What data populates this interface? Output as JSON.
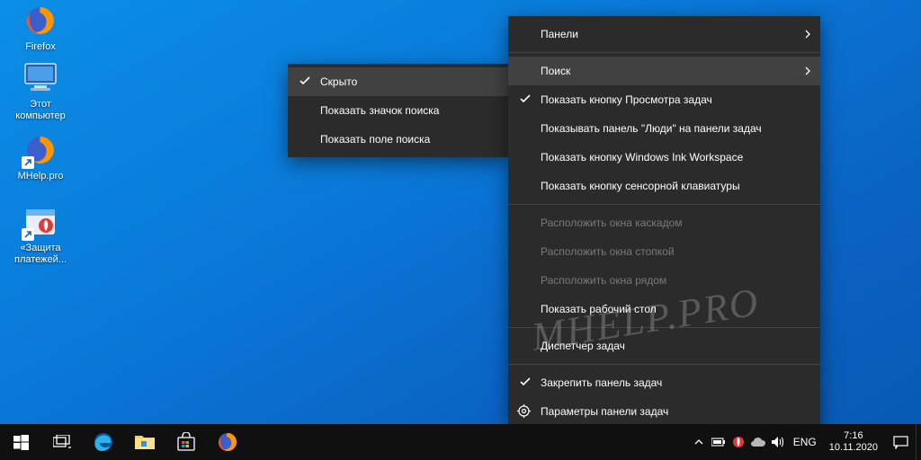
{
  "desktop_icons": {
    "firefox": "Firefox",
    "this_pc": "Этот\nкомпьютер",
    "mhelp": "MHelp.pro",
    "protection": "«Защита\nплатежей..."
  },
  "submenu": {
    "hidden": "Скрыто",
    "show_icon": "Показать значок поиска",
    "show_box": "Показать поле поиска"
  },
  "mainmenu": {
    "panels": "Панели",
    "search": "Поиск",
    "task_view": "Показать кнопку Просмотра задач",
    "people": "Показывать панель \"Люди\" на панели задач",
    "ink": "Показать кнопку Windows Ink Workspace",
    "touchkb": "Показать кнопку сенсорной клавиатуры",
    "cascade": "Расположить окна каскадом",
    "stacked": "Расположить окна стопкой",
    "sidebyside": "Расположить окна рядом",
    "show_desktop": "Показать рабочий стол",
    "task_manager": "Диспетчер задач",
    "lock": "Закрепить панель задач",
    "settings": "Параметры панели задач"
  },
  "tray": {
    "lang": "ENG",
    "time": "7:16",
    "date": "10.11.2020"
  },
  "watermark": "MHELP.PRO"
}
